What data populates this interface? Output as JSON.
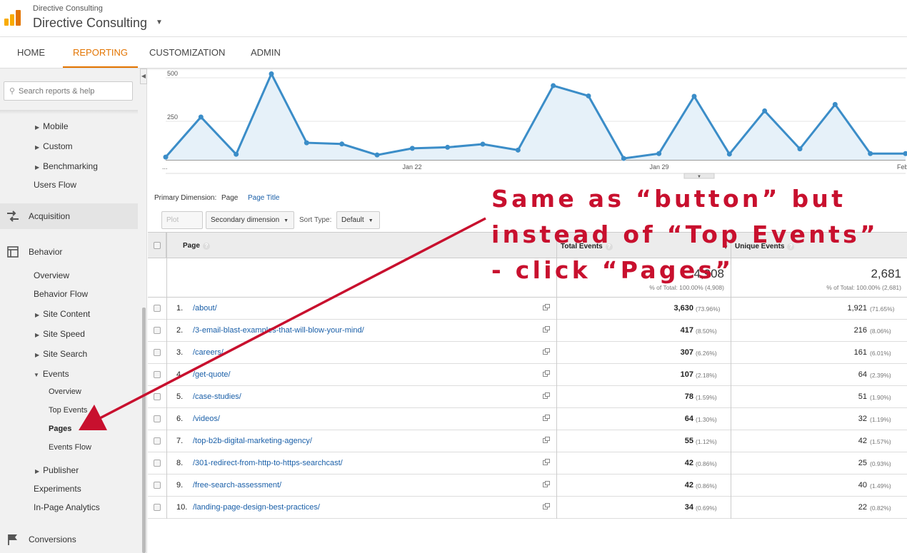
{
  "header": {
    "account_small": "Directive Consulting",
    "account_name": "Directive Consulting"
  },
  "nav": {
    "tabs": [
      {
        "label": "HOME"
      },
      {
        "label": "REPORTING"
      },
      {
        "label": "CUSTOMIZATION"
      },
      {
        "label": "ADMIN"
      }
    ],
    "active": "REPORTING"
  },
  "sidebar": {
    "search_placeholder": "Search reports & help",
    "items": {
      "mobile": "Mobile",
      "custom": "Custom",
      "benchmarking": "Benchmarking",
      "users_flow": "Users Flow",
      "acquisition": "Acquisition",
      "behavior": "Behavior",
      "overview": "Overview",
      "behavior_flow": "Behavior Flow",
      "site_content": "Site Content",
      "site_speed": "Site Speed",
      "site_search": "Site Search",
      "events": "Events",
      "events_overview": "Overview",
      "top_events": "Top Events",
      "pages": "Pages",
      "events_flow": "Events Flow",
      "publisher": "Publisher",
      "experiments": "Experiments",
      "in_page_analytics": "In-Page Analytics",
      "conversions": "Conversions"
    }
  },
  "chart_data": {
    "type": "area",
    "y_ticks": [
      "500",
      "250"
    ],
    "ylim": [
      0,
      500
    ],
    "x_labels": {
      "first": "...",
      "jan22": "Jan 22",
      "jan29": "Jan 29",
      "last": "Feb"
    },
    "values": [
      16,
      246,
      32,
      494,
      98,
      91,
      28,
      66,
      72,
      90,
      56,
      426,
      367,
      8,
      36,
      365,
      33,
      281,
      63,
      318,
      36,
      36
    ],
    "color": "#3b8dc8"
  },
  "dimension": {
    "label": "Primary Dimension:",
    "current": "Page",
    "alternate": "Page Title"
  },
  "toolbar": {
    "plot_rows": "Plot Rows",
    "secondary_dimension": "Secondary dimension",
    "sort_type_label": "Sort Type:",
    "sort_type_value": "Default"
  },
  "table": {
    "headers": {
      "page": "Page",
      "total_events": "Total Events",
      "unique_events": "Unique Events"
    },
    "totals": {
      "total_events": "4,908",
      "total_events_pct": "% of Total: 100.00% (4,908)",
      "unique_events": "2,681",
      "unique_events_pct": "% of Total: 100.00% (2,681)"
    },
    "rows": [
      {
        "num": "1.",
        "page": "/about/",
        "total": "3,630",
        "total_pct": "(73.96%)",
        "unique": "1,921",
        "unique_pct": "(71.65%)"
      },
      {
        "num": "2.",
        "page": "/3-email-blast-examples-that-will-blow-your-mind/",
        "total": "417",
        "total_pct": "(8.50%)",
        "unique": "216",
        "unique_pct": "(8.06%)"
      },
      {
        "num": "3.",
        "page": "/careers/",
        "total": "307",
        "total_pct": "(6.26%)",
        "unique": "161",
        "unique_pct": "(6.01%)"
      },
      {
        "num": "4.",
        "page": "/get-quote/",
        "total": "107",
        "total_pct": "(2.18%)",
        "unique": "64",
        "unique_pct": "(2.39%)"
      },
      {
        "num": "5.",
        "page": "/case-studies/",
        "total": "78",
        "total_pct": "(1.59%)",
        "unique": "51",
        "unique_pct": "(1.90%)"
      },
      {
        "num": "6.",
        "page": "/videos/",
        "total": "64",
        "total_pct": "(1.30%)",
        "unique": "32",
        "unique_pct": "(1.19%)"
      },
      {
        "num": "7.",
        "page": "/top-b2b-digital-marketing-agency/",
        "total": "55",
        "total_pct": "(1.12%)",
        "unique": "42",
        "unique_pct": "(1.57%)"
      },
      {
        "num": "8.",
        "page": "/301-redirect-from-http-to-https-searchcast/",
        "total": "42",
        "total_pct": "(0.86%)",
        "unique": "25",
        "unique_pct": "(0.93%)"
      },
      {
        "num": "9.",
        "page": "/free-search-assessment/",
        "total": "42",
        "total_pct": "(0.86%)",
        "unique": "40",
        "unique_pct": "(1.49%)"
      },
      {
        "num": "10.",
        "page": "/landing-page-design-best-practices/",
        "total": "34",
        "total_pct": "(0.69%)",
        "unique": "22",
        "unique_pct": "(0.82%)"
      }
    ]
  },
  "annotation": {
    "line1": "Same as “button” but",
    "line2": "instead of “Top Events”",
    "line3": "- click “Pages”",
    "color": "#c8102e"
  }
}
